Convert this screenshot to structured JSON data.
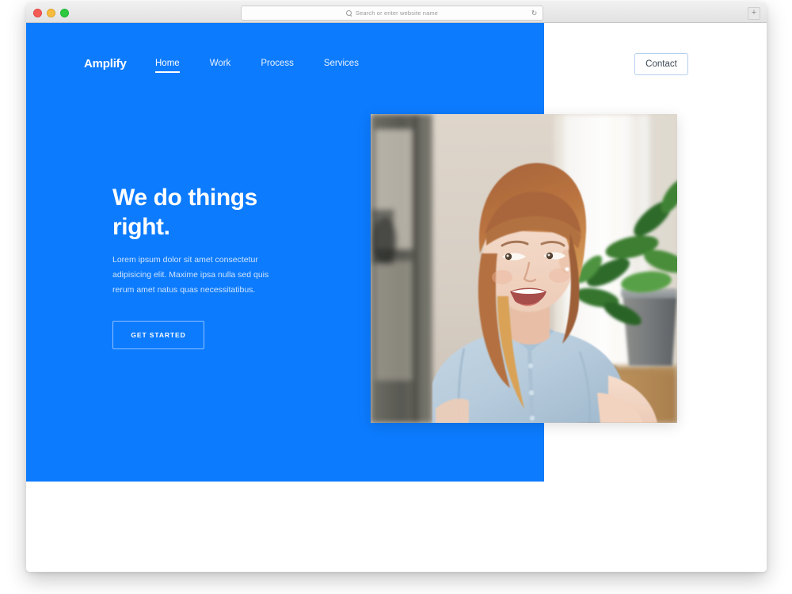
{
  "browser": {
    "traffic_lights": [
      {
        "name": "close",
        "color": "#f45b54"
      },
      {
        "name": "minimize",
        "color": "#f6bc3f"
      },
      {
        "name": "maximize",
        "color": "#2dc93f"
      }
    ],
    "address_bar": {
      "value": "",
      "placeholder": "Search or enter website name",
      "search_icon": "search-icon",
      "reload_icon": "reload-icon",
      "reload_glyph": "↻"
    },
    "new_tab": {
      "icon": "plus-icon",
      "glyph": "+"
    }
  },
  "site": {
    "brand": "Amplify",
    "accent_color": "#0c7bfe",
    "nav": [
      {
        "label": "Home",
        "active": true
      },
      {
        "label": "Work",
        "active": false
      },
      {
        "label": "Process",
        "active": false
      },
      {
        "label": "Services",
        "active": false
      }
    ],
    "contact_button": "Contact",
    "hero": {
      "heading": "We do things right.",
      "subtext": "Lorem ipsum dolor sit amet consectetur adipisicing elit. Maxime ipsa nulla sed quis rerum amet natus quas necessitatibus.",
      "cta_label": "GET STARTED",
      "photo_alt": "Smiling woman with auburn hair in a light blue denim shirt, green plant in grey pot behind her"
    }
  }
}
